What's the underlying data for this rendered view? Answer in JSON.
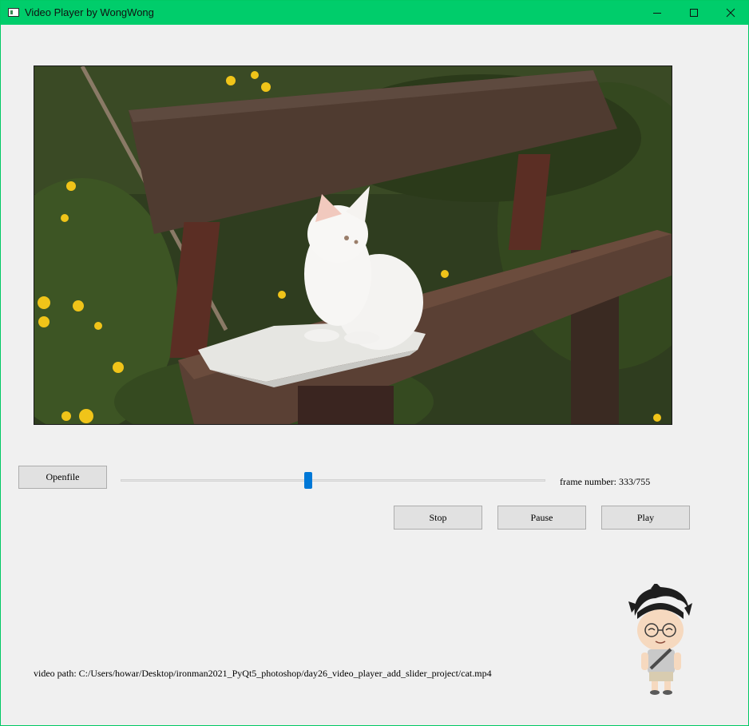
{
  "window": {
    "title": "Video Player by WongWong",
    "controls": [
      "minimize-icon",
      "maximize-icon",
      "close-icon"
    ],
    "titlebar_color": "#00cd6b"
  },
  "video": {
    "content": "white kitten sitting on a towel on a wooden bench, dandelions and grass behind"
  },
  "controls": {
    "openfile_label": "Openfile",
    "stop_label": "Stop",
    "pause_label": "Pause",
    "play_label": "Play"
  },
  "slider": {
    "current_frame": 333,
    "total_frames": 755,
    "accent_color": "#0078d7"
  },
  "frame_label": {
    "prefix": "frame number: ",
    "value": "333/755"
  },
  "path": {
    "prefix": "video path: ",
    "value": "C:/Users/howar/Desktop/ironman2021_PyQt5_photoshop/day26_video_player_add_slider_project/cat.mp4"
  },
  "avatar": {
    "content": "cartoon character with glasses"
  }
}
